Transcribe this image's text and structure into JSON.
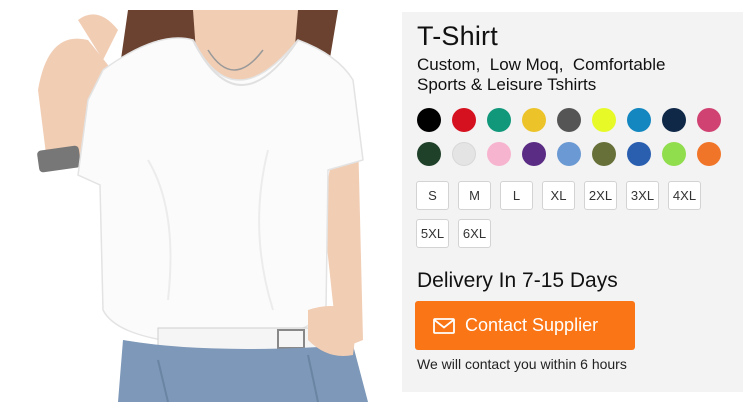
{
  "product": {
    "title": "T-Shirt",
    "subtitle_line1": "Custom,  Low Moq,  Comfortable",
    "subtitle_line2": "Sports & Leisure Tshirts"
  },
  "colors": [
    "#000000",
    "#d6111f",
    "#11987a",
    "#ecc42a",
    "#555555",
    "#e7fa27",
    "#1487c0",
    "#0f2848",
    "#d04271",
    "#1f4029",
    "#e4e4e4",
    "#f7b4cf",
    "#5a2c84",
    "#6b99d3",
    "#68703a",
    "#2a5fb0",
    "#90dd4d",
    "#f17528"
  ],
  "sizes": [
    "S",
    "M",
    "L",
    "XL",
    "2XL",
    "3XL",
    "4XL",
    "5XL",
    "6XL"
  ],
  "delivery": "Delivery In 7-15 Days",
  "contact_button": {
    "label": "Contact Supplier",
    "icon": "mail-icon",
    "color": "#f97516"
  },
  "note": "We will contact you within 6 hours"
}
